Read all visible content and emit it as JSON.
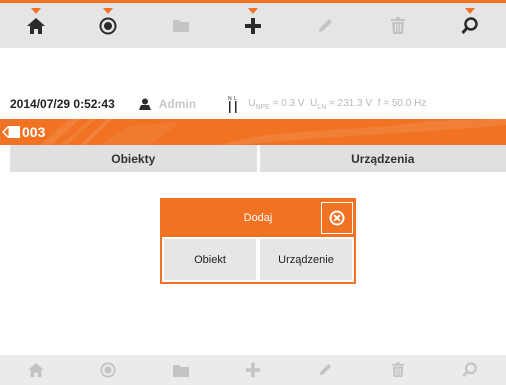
{
  "toolbar_top": {
    "items": [
      {
        "icon": "home-icon",
        "active": true
      },
      {
        "icon": "record-icon",
        "active": true
      },
      {
        "icon": "folder-icon",
        "active": false
      },
      {
        "icon": "plus-icon",
        "active": true
      },
      {
        "icon": "pencil-icon",
        "active": false
      },
      {
        "icon": "trash-icon",
        "active": false
      },
      {
        "icon": "search-icon",
        "active": true
      }
    ]
  },
  "status": {
    "datetime": "2014/07/29 0:52:43",
    "user": "Admin",
    "meas_upe_label": "U",
    "meas_upe_sub": "NPE",
    "meas_upe_value": " = 0.3 V",
    "meas_uln_label": "U",
    "meas_uln_sub": "LN",
    "meas_uln_value": " = 231.3 V",
    "meas_f": "f = 50.0 Hz"
  },
  "header": {
    "object_id": "003"
  },
  "tabs": [
    {
      "label": "Obiekty"
    },
    {
      "label": "Urządzenia"
    }
  ],
  "dialog": {
    "title": "Dodaj",
    "button_object": "Obiekt",
    "button_device": "Urządzenie"
  },
  "colors": {
    "accent": "#f07222",
    "toolbar_bg": "#e5e5e5",
    "icon_active": "#2b2b2b",
    "icon_inactive": "#c4c4c4"
  }
}
